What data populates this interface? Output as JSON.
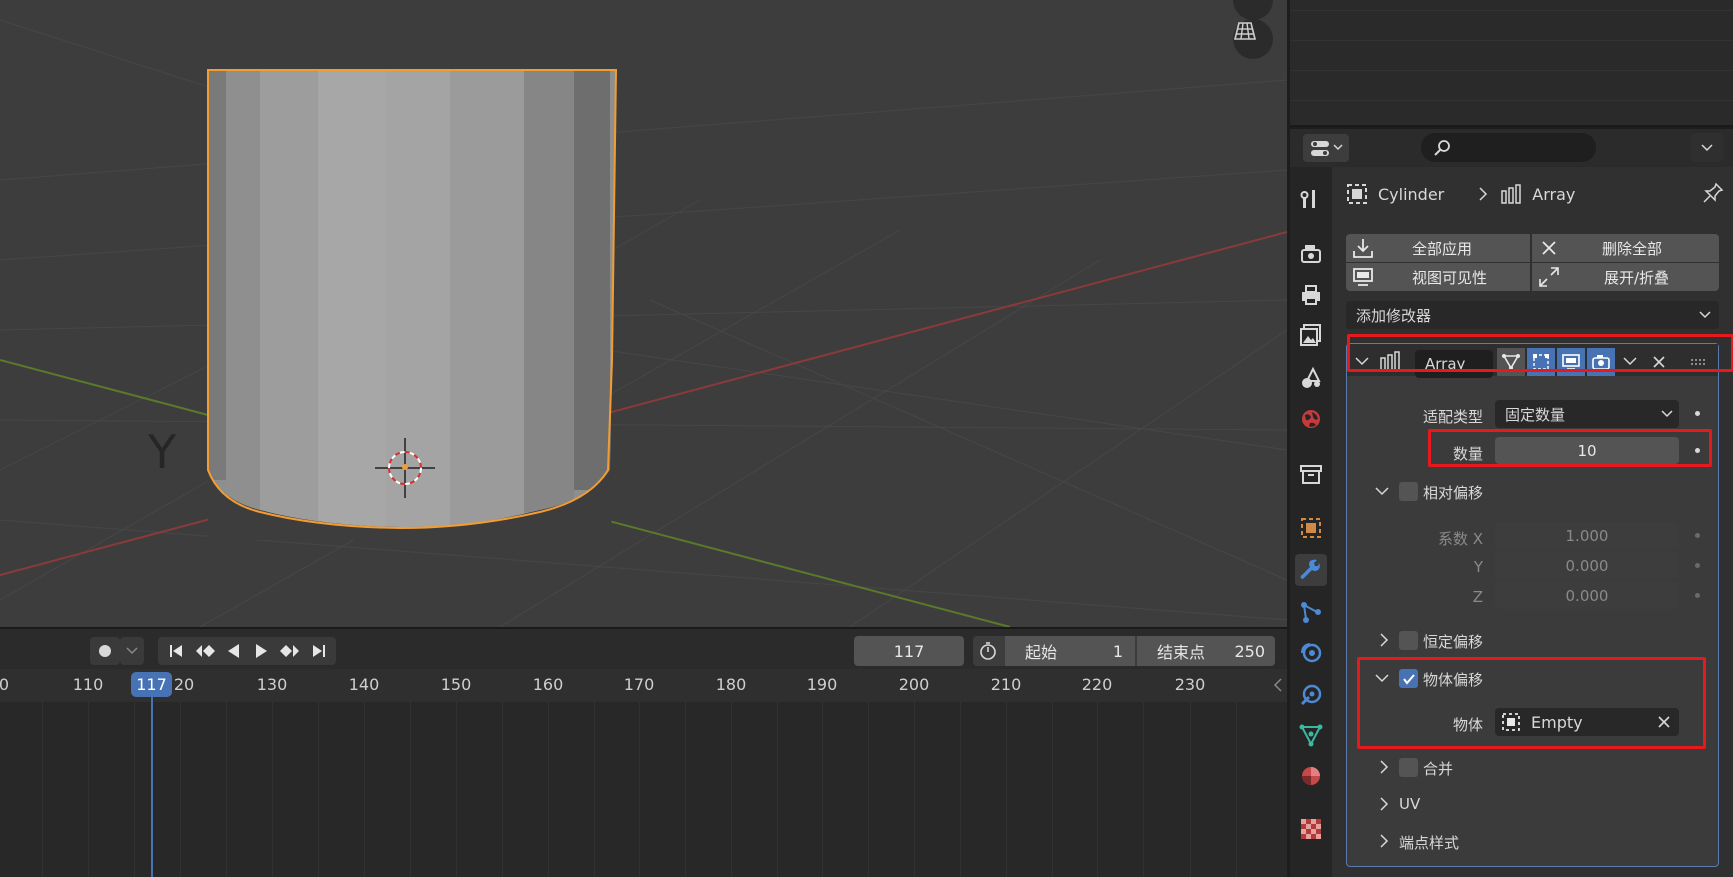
{
  "viewport": {
    "axis_label": "Y"
  },
  "timeline": {
    "current_frame": "117",
    "start_label": "起始",
    "start_value": "1",
    "end_label": "结束点",
    "end_value": "250",
    "ticks": [
      "0",
      "110",
      "20",
      "130",
      "140",
      "150",
      "160",
      "170",
      "180",
      "190",
      "200",
      "210",
      "220",
      "230"
    ],
    "playhead": "117"
  },
  "properties": {
    "breadcrumb": {
      "object": "Cylinder",
      "modifier": "Array"
    },
    "apply_all": "全部应用",
    "delete_all": "删除全部",
    "viewport_visibility": "视图可见性",
    "expand_collapse": "展开/折叠",
    "add_modifier": "添加修改器",
    "modifier": {
      "name": "Array",
      "fit_type_label": "适配类型",
      "fit_type_value": "固定数量",
      "count_label": "数量",
      "count_value": "10",
      "relative_offset": "相对偏移",
      "factor_x_label": "系数 X",
      "factor_x": "1.000",
      "y_label": "Y",
      "factor_y": "0.000",
      "z_label": "Z",
      "factor_z": "0.000",
      "constant_offset": "恒定偏移",
      "object_offset": "物体偏移",
      "object_label": "物体",
      "object_value": "Empty",
      "merge": "合并",
      "uv": "UV",
      "caps": "端点样式"
    }
  },
  "colors": {
    "selection_outline": "#f39c32",
    "highlight": "#e8191c",
    "accent": "#4772b3"
  }
}
